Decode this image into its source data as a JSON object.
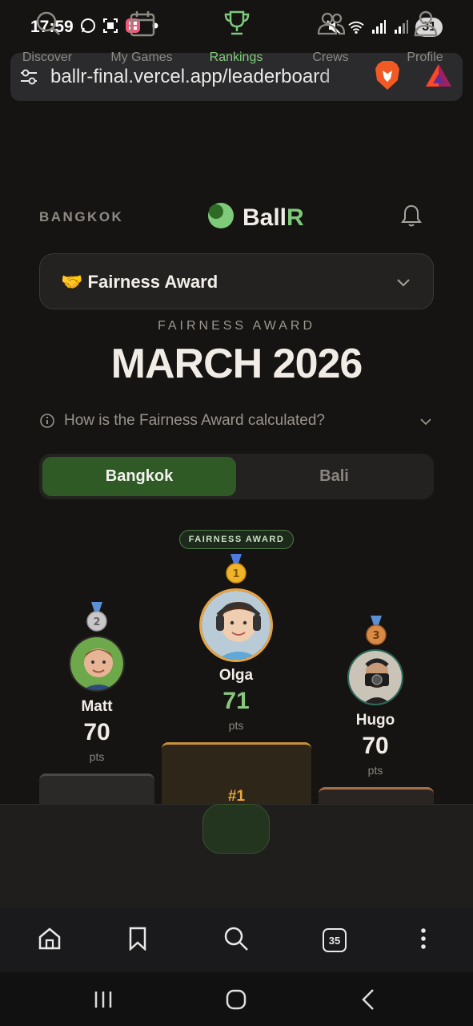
{
  "status_bar": {
    "time": "17:59",
    "battery": "31",
    "icons_left": [
      "whatsapp-icon",
      "screen-capture-icon",
      "app-icon",
      "dot-icon"
    ],
    "icons_right": [
      "mute-icon",
      "wifi-icon",
      "signal-icon",
      "signal-icon"
    ]
  },
  "browser": {
    "url": "ballr-final.vercel.app/leaderboard",
    "tabs_count": "35"
  },
  "header": {
    "city": "BANGKOK",
    "logo_main": "Ball",
    "logo_accent": "R"
  },
  "award_select": {
    "emoji": "🤝",
    "label": "Fairness Award"
  },
  "award": {
    "kicker": "FAIRNESS AWARD",
    "period": "MARCH 2026"
  },
  "faq": {
    "question": "How is the Fairness Award calculated?"
  },
  "city_toggle": {
    "options": [
      "Bangkok",
      "Bali"
    ],
    "selected": "Bangkok"
  },
  "podium": {
    "badge": "FAIRNESS AWARD",
    "players": [
      {
        "rank": 2,
        "name": "Matt",
        "score": "70",
        "unit": "pts",
        "medal": "2"
      },
      {
        "rank": 1,
        "name": "Olga",
        "score": "71",
        "unit": "pts",
        "medal": "1",
        "block_label": "#1"
      },
      {
        "rank": 3,
        "name": "Hugo",
        "score": "70",
        "unit": "pts",
        "medal": "3"
      }
    ]
  },
  "bottom_nav": {
    "items": [
      {
        "label": "Discover",
        "icon": "search-icon"
      },
      {
        "label": "My Games",
        "icon": "calendar-icon"
      },
      {
        "label": "Rankings",
        "icon": "trophy-icon",
        "active": true
      },
      {
        "label": "Crews",
        "icon": "users-icon"
      },
      {
        "label": "Profile",
        "icon": "user-icon"
      }
    ]
  },
  "colors": {
    "background": "#151413",
    "accent_green": "#7fc97a",
    "toggle_active": "#2f5a25",
    "gold": "#e7a441"
  }
}
